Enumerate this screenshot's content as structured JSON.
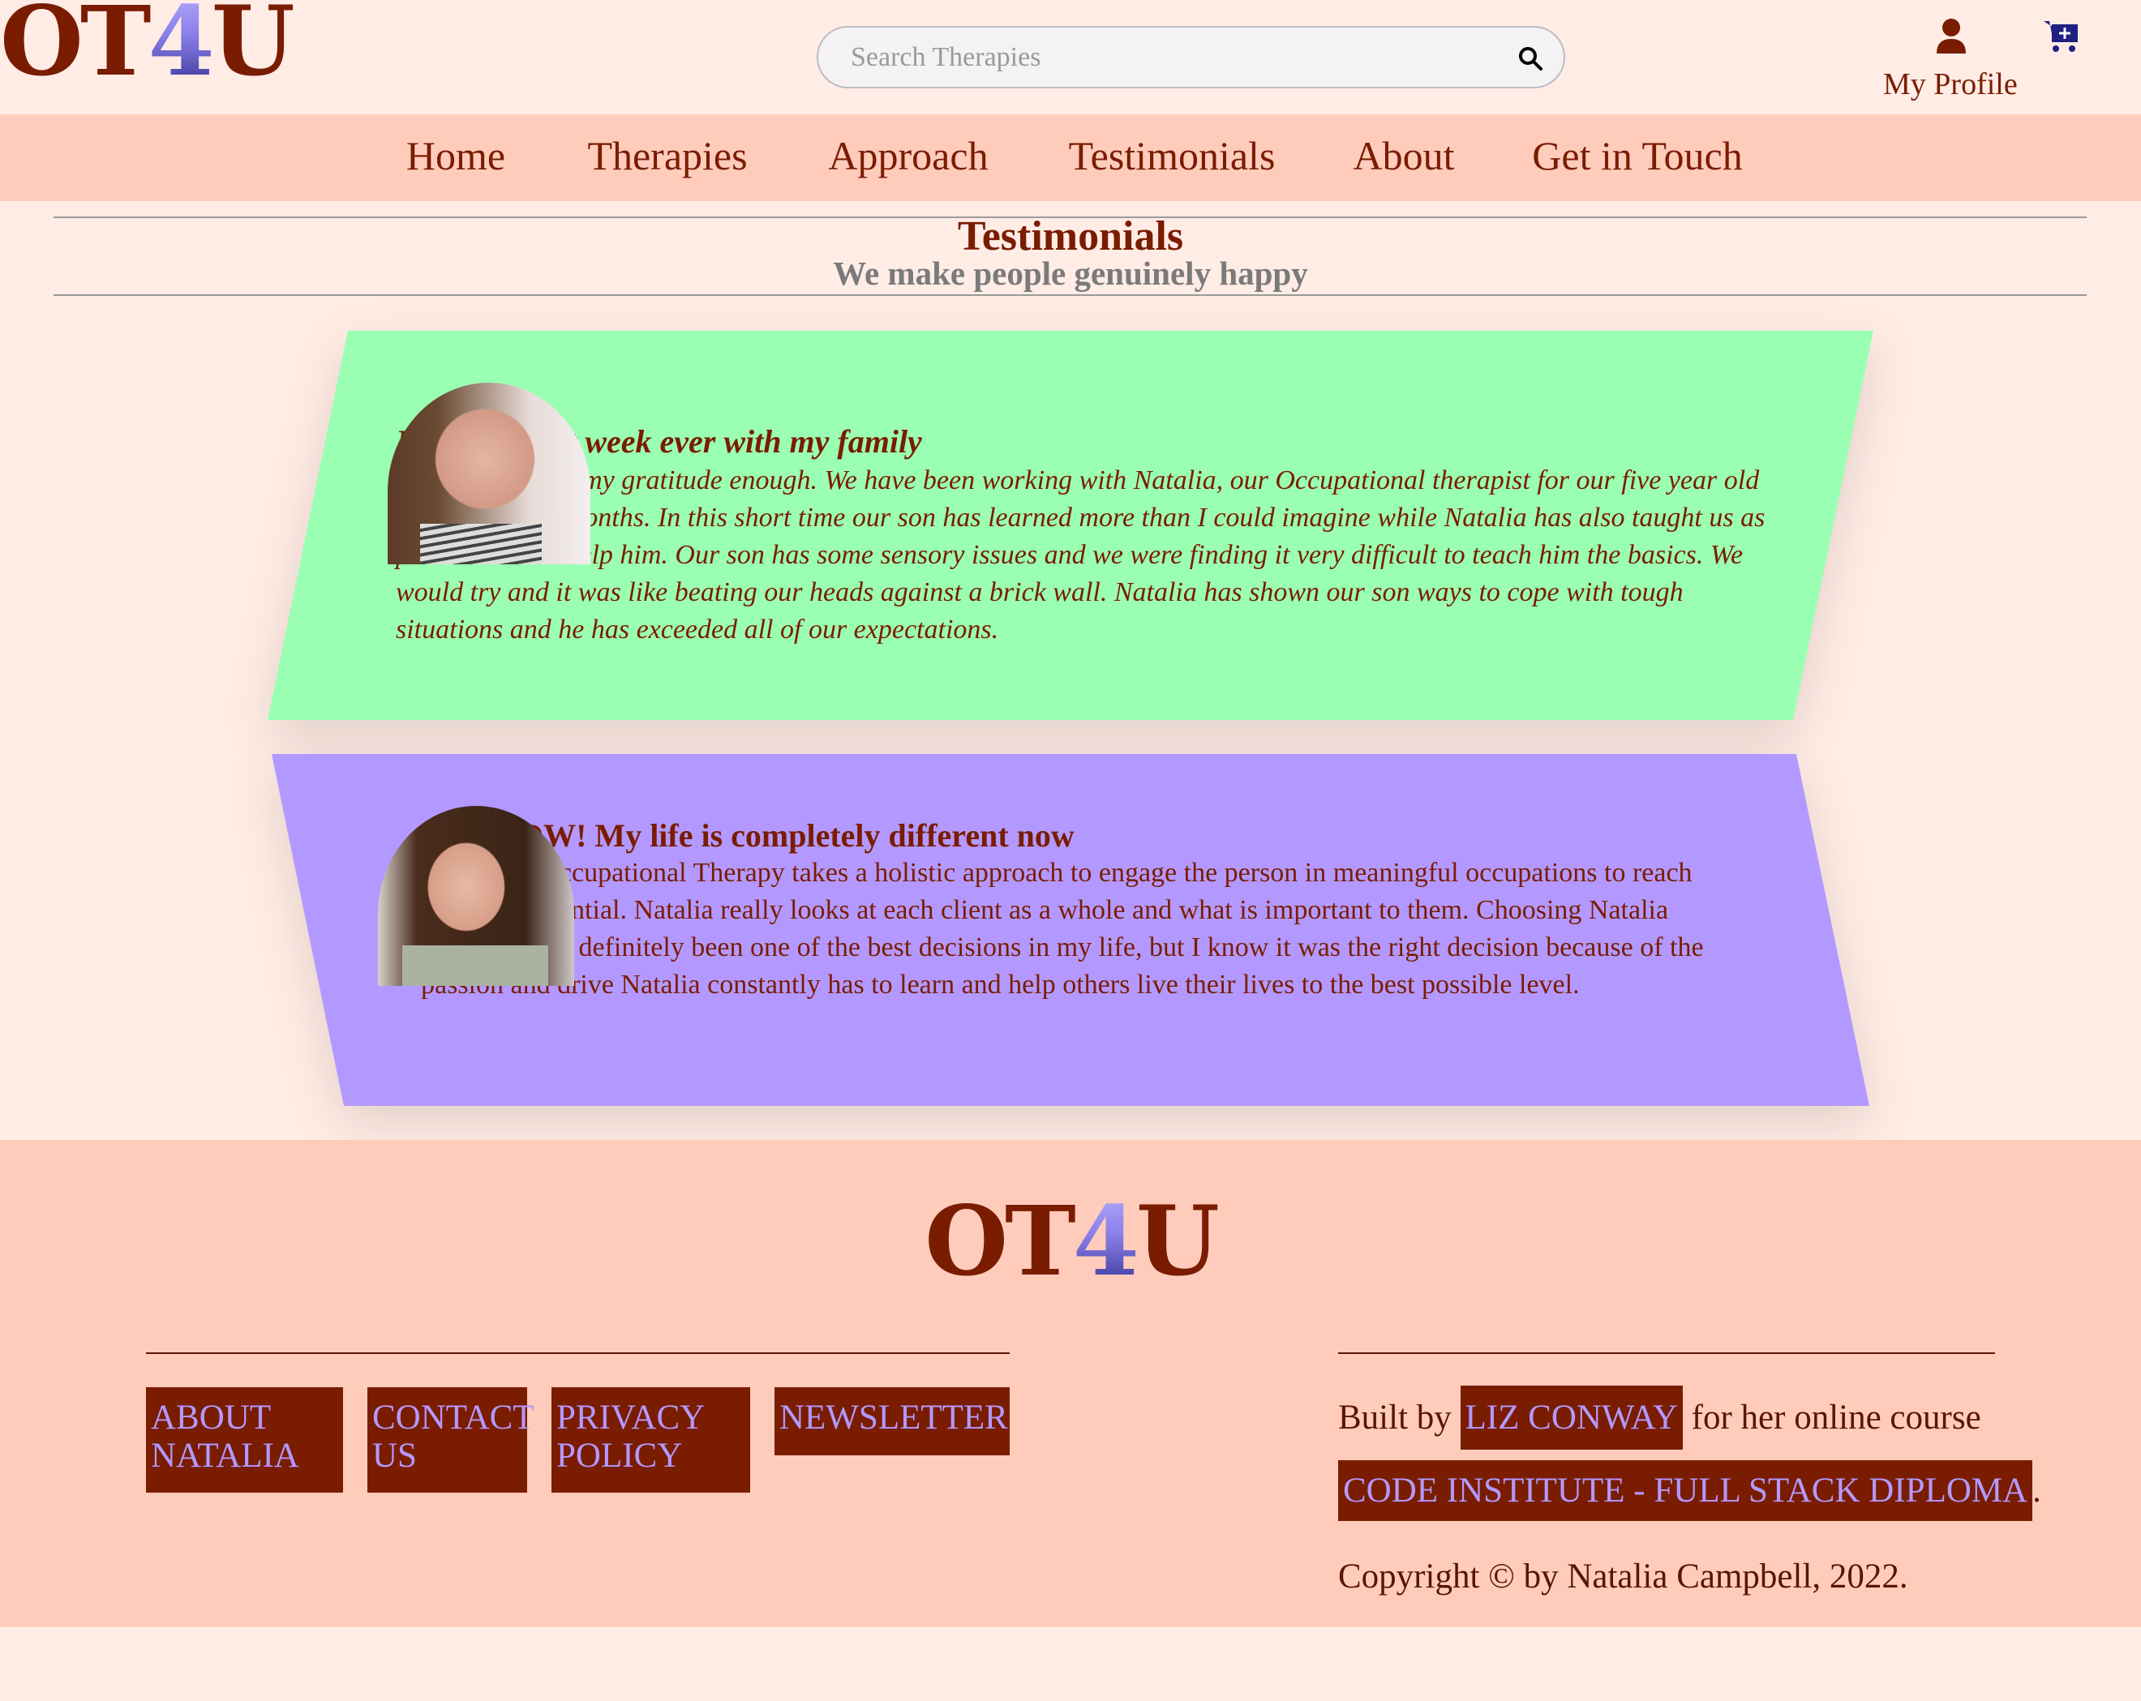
{
  "brand": {
    "logo_prefix": "OT",
    "logo_four": "4",
    "logo_suffix": "U"
  },
  "header": {
    "search_placeholder": "Search Therapies",
    "search_icon": "magnifier-icon",
    "profile_label": "My Profile",
    "profile_icon": "user-icon",
    "cart_icon": "cart-plus-icon"
  },
  "nav": {
    "items": [
      {
        "label": "Home"
      },
      {
        "label": "Therapies"
      },
      {
        "label": "Approach"
      },
      {
        "label": "Testimonials"
      },
      {
        "label": "About"
      },
      {
        "label": "Get in Touch"
      }
    ]
  },
  "page": {
    "title": "Testimonials",
    "subtitle": "We make people genuinely happy"
  },
  "testimonials": [
    {
      "title": "I had the best week ever with my family",
      "text": "I cannot express my gratitude enough. We have been working with Natalia, our Occupational therapist for our five year old for close to six months. In this short time our son has learned more than I could imagine while Natalia has also taught us as parents how to help him. Our son has some sensory issues and we were finding it very difficult to teach him the basics. We would try and it was like beating our heads against a brick wall. Natalia has shown our son ways to cope with tough situations and he has exceeded all of our expectations.",
      "color": "#9affb2"
    },
    {
      "title": "WOW! My life is completely different now",
      "text": "I love that Occupational Therapy takes a holistic approach to engage the person in meaningful occupations to reach their full potential. Natalia really looks at each client as a whole and what is important to them. Choosing Natalia Campbell has definitely been one of the best decisions in my life, but I know it was the right decision because of the passion and drive Natalia constantly has to learn and help others live their lives to the best possible level.",
      "color": "#b399ff"
    }
  ],
  "footer": {
    "links": [
      {
        "label": "About Natalia"
      },
      {
        "label": "Contact Us"
      },
      {
        "label": "Privacy Policy"
      },
      {
        "label": "Newsletter"
      }
    ],
    "built_by_prefix": "Built by",
    "author_link": "LIZ CONWAY",
    "built_by_suffix": "for her online course",
    "course_link": "CODE INSTITUTE - FULL STACK DIPLOMA",
    "course_suffix": ".",
    "copyright": "Copyright © by Natalia Campbell, 2022."
  },
  "colors": {
    "primary": "#7a1c00",
    "nav_bg": "#ffccbc",
    "page_bg": "#ffece5",
    "accent_lavender": "#b399ff",
    "accent_green": "#9affb2"
  }
}
